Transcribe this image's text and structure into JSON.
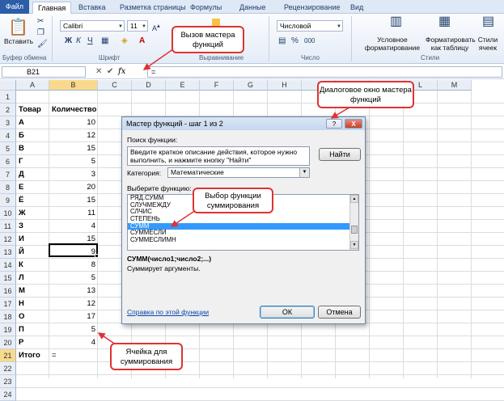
{
  "tabs": [
    "Файл",
    "Главная",
    "Вставка",
    "Разметка страницы",
    "Формулы",
    "Данные",
    "Рецензирование",
    "Вид"
  ],
  "ribbon": {
    "paste_label": "Вставить",
    "clipboard_group": "Буфер обмена",
    "font_name": "Calibri",
    "font_size": "11",
    "font_group": "Шрифт",
    "alignment_group": "Выравнивание",
    "number_format": "Числовой",
    "number_group": "Число",
    "cond_format": "Условное форматирование",
    "format_table": "Форматировать как таблицу",
    "cell_styles": "Стили ячеек",
    "styles_group": "Стили"
  },
  "formula_bar": {
    "name_box": "B21",
    "formula": "="
  },
  "sheet": {
    "columns": [
      "A",
      "B",
      "C",
      "D",
      "E",
      "F",
      "G",
      "H",
      "I",
      "J",
      "K",
      "L",
      "M"
    ],
    "rows": [
      "1",
      "2",
      "3",
      "4",
      "5",
      "6",
      "7",
      "8",
      "9",
      "10",
      "11",
      "12",
      "13",
      "14",
      "15",
      "16",
      "17",
      "18",
      "19",
      "20",
      "21",
      "22",
      "23",
      "24"
    ],
    "header_product": "Товар",
    "header_qty": "Количество",
    "data": [
      [
        "А",
        "10"
      ],
      [
        "Б",
        "12"
      ],
      [
        "В",
        "15"
      ],
      [
        "Г",
        "5"
      ],
      [
        "Д",
        "3"
      ],
      [
        "Е",
        "20"
      ],
      [
        "Ё",
        "15"
      ],
      [
        "Ж",
        "11"
      ],
      [
        "З",
        "4"
      ],
      [
        "И",
        "15"
      ],
      [
        "Й",
        "9"
      ],
      [
        "К",
        "8"
      ],
      [
        "Л",
        "5"
      ],
      [
        "М",
        "13"
      ],
      [
        "Н",
        "12"
      ],
      [
        "О",
        "17"
      ],
      [
        "П",
        "5"
      ],
      [
        "Р",
        "4"
      ]
    ],
    "total_label": "Итого",
    "total_value": "="
  },
  "dialog": {
    "title": "Мастер функций - шаг 1 из 2",
    "search_label": "Поиск функции:",
    "search_text": "Введите краткое описание действия, которое нужно выполнить, и нажмите кнопку \"Найти\"",
    "find_button": "Найти",
    "category_label": "Категория:",
    "category_value": "Математические",
    "select_label": "Выберите функцию:",
    "functions": [
      "РЯД.СУММ",
      "СЛУЧМЕЖДУ",
      "СЛЧИС",
      "СТЕПЕНЬ",
      "СУММ",
      "СУММЕСЛИ",
      "СУММЕСЛИМН"
    ],
    "selected_function": "СУММ",
    "signature": "СУММ(число1;число2;...)",
    "description": "Суммирует аргументы.",
    "help_link": "Справка по этой функции",
    "ok": "ОК",
    "cancel": "Отмена",
    "help_btn": "?",
    "close_btn": "X"
  },
  "callouts": {
    "fx_call": "Вызов мастера функций",
    "dialog_note": "Диалоговое окно мастера функций",
    "select_note": "Выбор функции суммирования",
    "cell_note": "Ячейка для суммирования"
  },
  "colors": {
    "callout_border": "#e03232",
    "selection": "#3399ff",
    "file_tab": "#2c5ea8"
  }
}
